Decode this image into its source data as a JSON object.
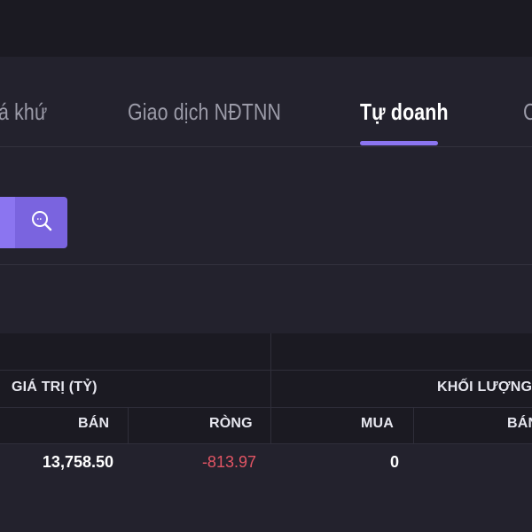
{
  "tabs": [
    {
      "label": "á khứ"
    },
    {
      "label": "Giao dịch NĐTNN"
    },
    {
      "label": "Tự doanh"
    },
    {
      "label": "C"
    }
  ],
  "active_tab": "Tự doanh",
  "colors": {
    "accent": "#8b75f0",
    "background": "#23222d",
    "header_bg": "#1b1a22",
    "negative": "#e25564"
  },
  "search": {
    "icon": "search-icon"
  },
  "table": {
    "groups": {
      "value": "GIÁ TRỊ (TỶ)",
      "volume": "KHỐI LƯỢNG"
    },
    "columns": {
      "sell": "BÁN",
      "net": "RÒNG",
      "buy": "MUA",
      "sell2": "BÁN"
    },
    "row": {
      "value_sell": "13,758.50",
      "value_net": "-813.97",
      "volume_buy": "0"
    }
  }
}
